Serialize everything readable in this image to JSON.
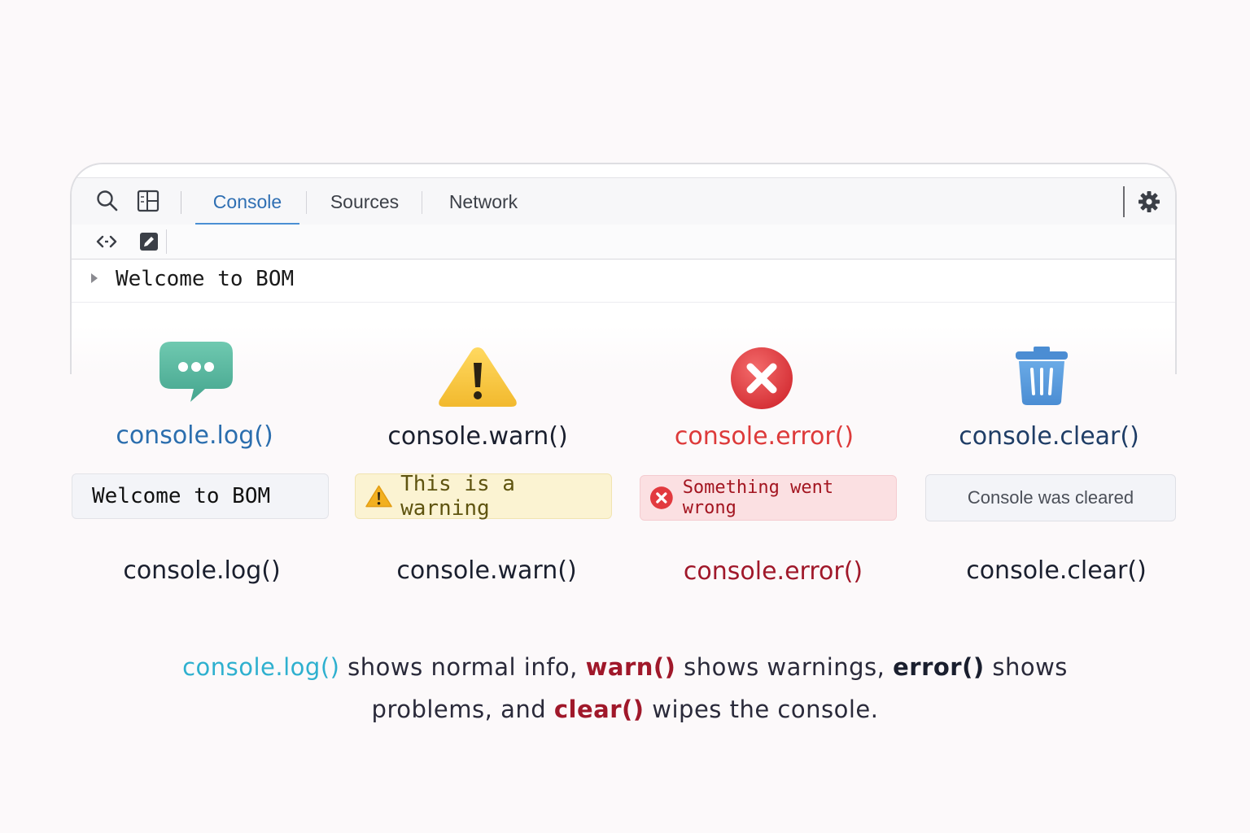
{
  "tabs": [
    {
      "label": "Console",
      "active": true
    },
    {
      "label": "Sources",
      "active": false
    },
    {
      "label": "Network",
      "active": false
    }
  ],
  "toolbar_icons": [
    "search-icon",
    "dock-panel-icon",
    "expand-arrows-icon",
    "edit-icon",
    "gear-icon"
  ],
  "console_log_line": "Welcome to BOM",
  "methods": {
    "log": {
      "title": "console.log()",
      "sample": "Welcome to BOM",
      "label": "console.log()",
      "icon": "speech-bubble-icon",
      "color": "#2b6eae"
    },
    "warn": {
      "title": "console.warn()",
      "sample": "This is a warning",
      "label": "console.warn()",
      "icon": "warning-icon",
      "color": "#1a1f2e"
    },
    "error": {
      "title": "console.error()",
      "sample": "Something went wrong",
      "label": "console.error()",
      "icon": "error-icon",
      "color": "#dd3a3a"
    },
    "clear": {
      "title": "console.clear()",
      "sample": "Console was cleared",
      "label": "console.clear()",
      "icon": "trash-icon",
      "color": "#1f3d66"
    }
  },
  "caption": {
    "line1": {
      "a": "console.log()",
      "b": " shows  normal  info, ",
      "c": "warn()",
      "d": " shows warnings, ",
      "e": "error()",
      "f": " shows"
    },
    "line2": {
      "a": "problems, and ",
      "b": "clear()",
      "c": " wipes the console."
    }
  }
}
